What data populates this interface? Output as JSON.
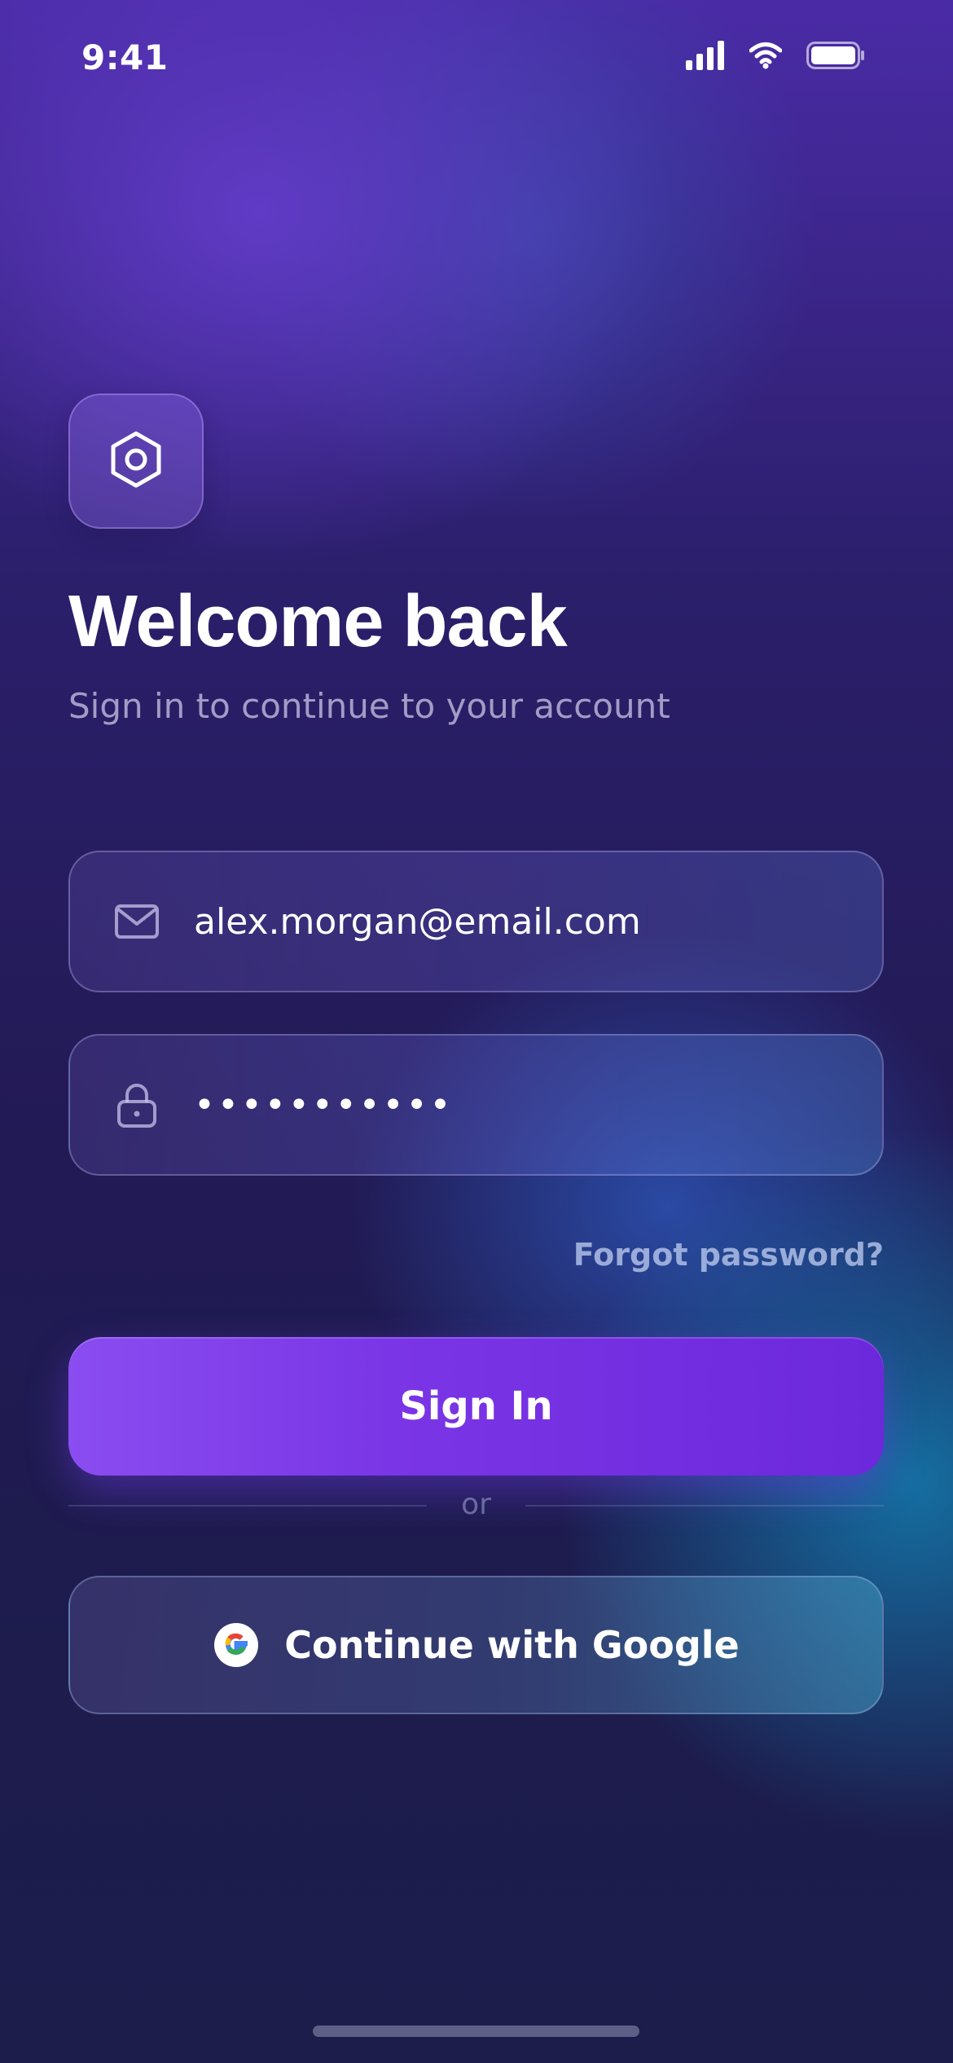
{
  "status_bar": {
    "time": "9:41",
    "icons": [
      "signal-icon",
      "wifi-icon",
      "battery-icon"
    ]
  },
  "app": {
    "logo_icon": "hexagon-icon"
  },
  "header": {
    "title": "Welcome back",
    "subtitle": "Sign in to continue to your account"
  },
  "form": {
    "email": {
      "icon": "mail-icon",
      "value": "alex.morgan@email.com"
    },
    "password": {
      "icon": "lock-icon",
      "value": "•••••••••••"
    },
    "forgot_password_label": "Forgot password?",
    "sign_in_label": "Sign In",
    "divider_label": "or",
    "google_label": "Continue with Google",
    "google_icon": "google-icon"
  },
  "colors": {
    "primary": "#7a35e6",
    "background_top": "#4a2ba6",
    "background_bottom": "#1c1d4b"
  }
}
